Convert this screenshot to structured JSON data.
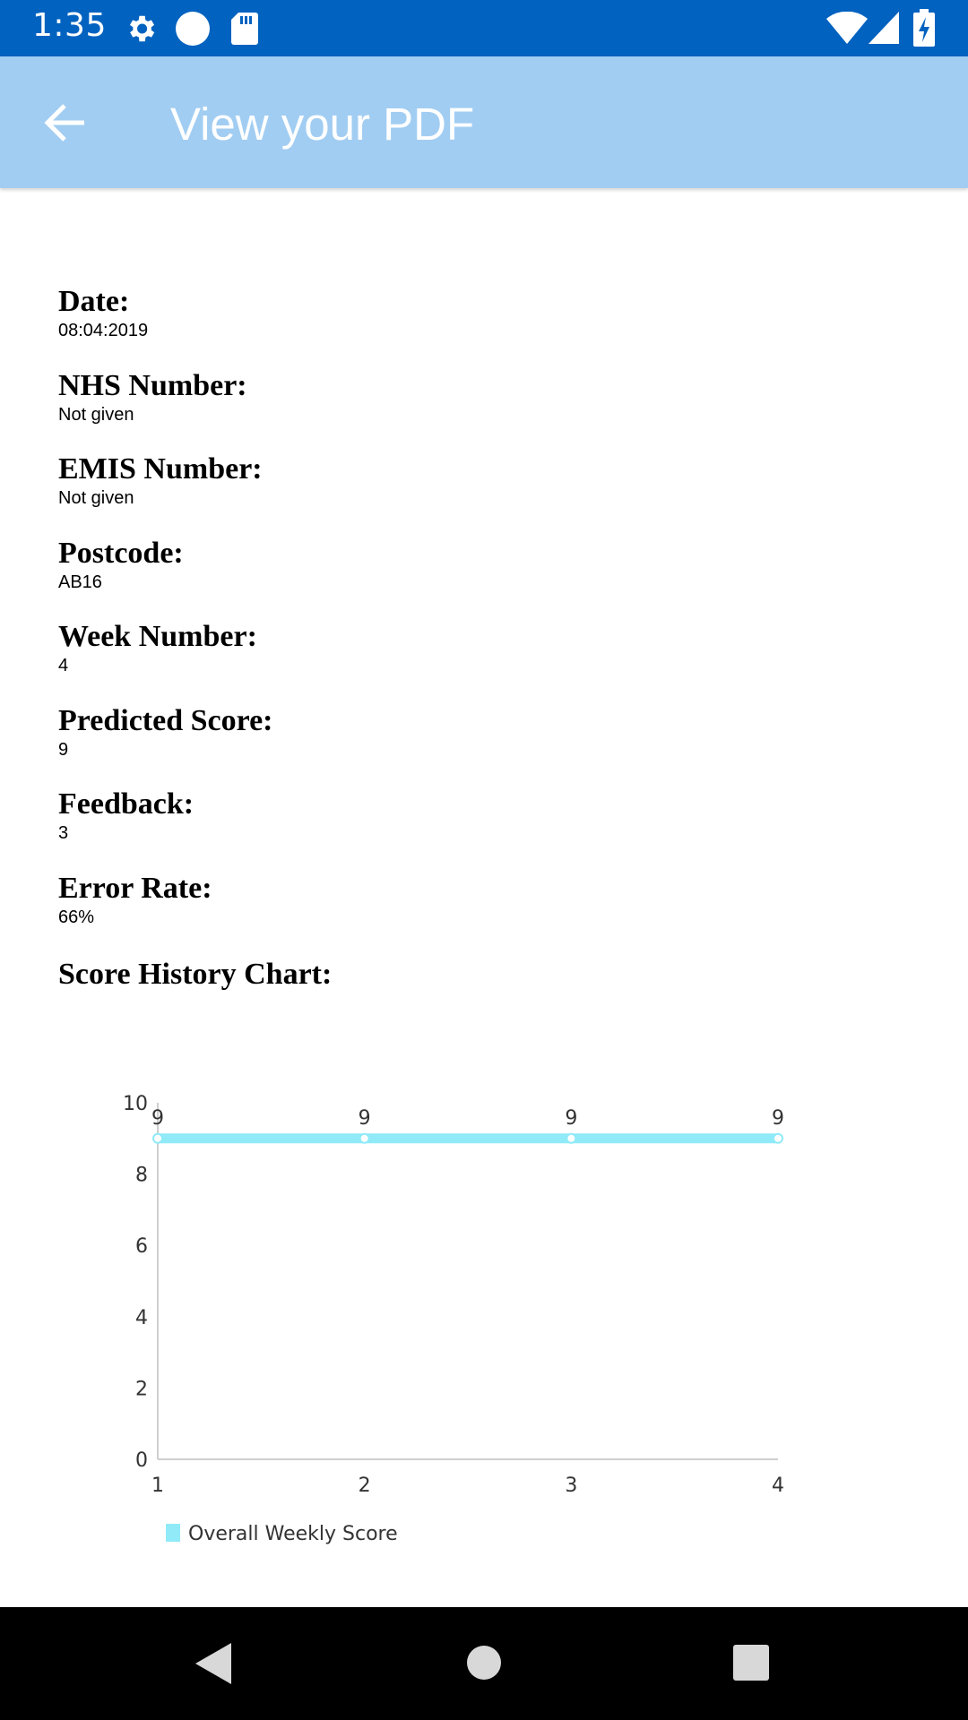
{
  "status_bar": {
    "time": "1:35",
    "icons": [
      "gear-icon",
      "circle-icon",
      "sd-card-icon",
      "wifi-icon",
      "signal-icon",
      "battery-charging-icon"
    ]
  },
  "app_bar": {
    "title": "View your PDF",
    "back_icon": "arrow-left-icon",
    "background": "#a2cdf2"
  },
  "document": {
    "fields": [
      {
        "label": "Date:",
        "value": "08:04:2019"
      },
      {
        "label": "NHS Number:",
        "value": "Not given"
      },
      {
        "label": "EMIS Number:",
        "value": "Not given"
      },
      {
        "label": "Postcode:",
        "value": "AB16"
      },
      {
        "label": "Week Number:",
        "value": "4"
      },
      {
        "label": "Predicted Score:",
        "value": "9"
      },
      {
        "label": "Feedback:",
        "value": "3"
      },
      {
        "label": "Error Rate:",
        "value": "66%"
      }
    ],
    "chart_heading": "Score History Chart:"
  },
  "chart_data": {
    "type": "line",
    "title": "",
    "xlabel": "",
    "ylabel": "",
    "x": [
      1,
      2,
      3,
      4
    ],
    "series": [
      {
        "name": "Overall Weekly Score",
        "values": [
          9,
          9,
          9,
          9
        ],
        "color": "#90eaf8"
      }
    ],
    "data_labels": [
      "9",
      "9",
      "9",
      "9"
    ],
    "x_ticks": [
      "1",
      "2",
      "3",
      "4"
    ],
    "y_ticks": [
      "0",
      "2",
      "4",
      "6",
      "8",
      "10"
    ],
    "ylim": [
      0,
      10
    ],
    "grid": false,
    "legend_position": "bottom-left"
  },
  "nav_bar": {
    "icons": [
      "back-triangle-icon",
      "home-circle-icon",
      "recents-square-icon"
    ]
  }
}
